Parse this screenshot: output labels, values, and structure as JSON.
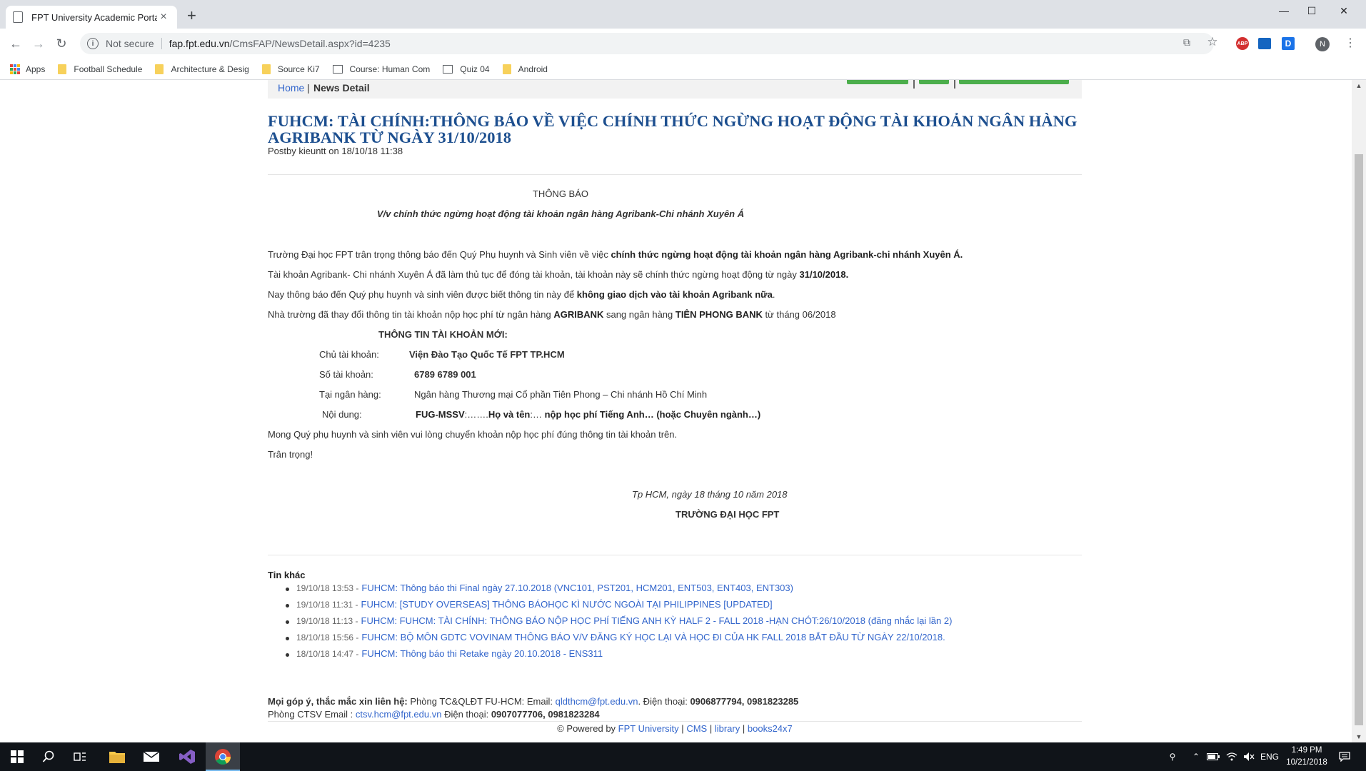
{
  "browser": {
    "tab_title": "FPT University Academic Portal",
    "tab_close": "×",
    "new_tab": "+",
    "not_secure": "Not secure",
    "url_host": "fap.fpt.edu.vn",
    "url_path": "/CmsFAP/NewsDetail.aspx?id=4235",
    "win_min": "—",
    "win_max": "☐",
    "win_close": "✕",
    "back": "←",
    "forward": "→",
    "reload": "↻",
    "info": "i",
    "translate": "⧉",
    "star": "☆",
    "abp": "ABP",
    "ext_d": "D",
    "profile_initial": "N",
    "menu": "⋮"
  },
  "bookmarks": [
    {
      "label": "Apps",
      "icon": "apps-icon"
    },
    {
      "label": "Football Schedule",
      "icon": "folder-icon"
    },
    {
      "label": "Architecture & Desig",
      "icon": "folder-icon"
    },
    {
      "label": "Source Ki7",
      "icon": "folder-icon"
    },
    {
      "label": "Course: Human Com",
      "icon": "page-icon"
    },
    {
      "label": "Quiz 04",
      "icon": "page-icon"
    },
    {
      "label": "Android",
      "icon": "folder-icon"
    }
  ],
  "breadcrumb": {
    "home": "Home",
    "separator": "|",
    "current": "News Detail"
  },
  "news": {
    "title": "FUHCM: TÀI CHÍNH:THÔNG BÁO VỀ VIỆC CHÍNH THỨC NGỪNG HOẠT ĐỘNG TÀI KHOẢN NGÂN HÀNG AGRIBANK TỪ NGÀY 31/10/2018",
    "postby": "Postby kieuntt on 18/10/18 11:38"
  },
  "body": {
    "heading": "THÔNG BÁO",
    "subheading": "V/v chính thức ngừng hoạt động tài khoản ngân hàng Agribank-Chi nhánh Xuyên Á",
    "p1a": "Trường Đại học FPT trân trọng thông báo đến Quý Phụ huynh và Sinh viên về việc ",
    "p1b": "chính thức ngừng hoạt động tài khoản ngân hàng Agribank-chi nhánh Xuyên Á.",
    "p2a": "Tài khoản Agribank- Chi nhánh Xuyên Á đã làm thủ tục để đóng tài khoản,  tài khoản này sẽ chính thức ngừng hoạt động từ ngày ",
    "p2b": "31/10/2018.",
    "p3a": "Nay thông báo đến Quý phụ huynh và sinh viên được biết thông tin này để ",
    "p3b": "không giao dịch vào tài khoản Agribank nữa",
    "p3c": ".",
    "p4a": "Nhà trường đã thay đổi thông tin tài khoản nộp học phí từ ngân hàng ",
    "p4b": "AGRIBANK",
    "p4c": " sang ngân hàng ",
    "p4d": "TIÊN PHONG BANK",
    "p4e": " từ tháng 06/2018",
    "new_account_heading": "THÔNG TIN TÀI KHOẢN MỚI:",
    "owner_label": "Chủ tài khoản:",
    "owner_value": "Viện Đào Tạo Quốc Tế FPT TP.HCM",
    "number_label": "Số tài khoản:",
    "number_value": "6789 6789 001",
    "bank_label": "Tại ngân hàng:",
    "bank_value": "Ngân hàng Thương mại Cổ phần Tiên Phong – Chi nhánh Hồ Chí Minh",
    "content_label": "Nội dung:",
    "content_a": "FUG-MSSV",
    "content_b": ":…….",
    "content_c": "Họ và tên",
    "content_d": ":…  ",
    "content_e": "nộp học phí Tiếng Anh… (hoặc Chuyên ngành…)",
    "closing": "Mong Quý phụ huynh và sinh viên vui lòng chuyển khoản nộp học phí đúng thông tin tài khoản trên.",
    "regards": "Trân trọng!",
    "date_line": "Tp HCM, ngày 18 tháng 10 năm 2018",
    "signature": "TRƯỜNG ĐẠI HỌC FPT"
  },
  "other_news": {
    "heading": "Tin khác",
    "items": [
      {
        "date": "19/10/18 13:53 -",
        "title": "FUHCM: Thông báo thi Final ngày 27.10.2018 (VNC101, PST201, HCM201, ENT503, ENT403, ENT303)"
      },
      {
        "date": "19/10/18 11:31 -",
        "title": "FUHCM: [STUDY OVERSEAS] THÔNG BÁOHỌC KÌ NƯỚC NGOÀI TẠI PHILIPPINES [UPDATED]"
      },
      {
        "date": "19/10/18 11:13 -",
        "title": "FUHCM: FUHCM: TÀI CHÍNH: THÔNG BÁO NỘP HỌC PHÍ TIẾNG ANH KỲ HALF 2 - FALL 2018 -HẠN CHÓT:26/10/2018 (đăng nhắc lại lần 2)"
      },
      {
        "date": "18/10/18 15:56 -",
        "title": "FUHCM: BỘ MÔN GDTC VOVINAM THÔNG BÁO V/V ĐĂNG KÝ HỌC LẠI VÀ HỌC ĐI CỦA HK FALL 2018 BẮT ĐẦU TỪ NGÀY 22/10/2018."
      },
      {
        "date": "18/10/18 14:47 -",
        "title": "FUHCM: Thông báo thi Retake ngày 20.10.2018 - ENS311"
      }
    ]
  },
  "footer": {
    "line1_label": "Mọi góp ý, thắc mắc xin liên hệ:",
    "line1_a": " Phòng TC&QLĐT FU-HCM: Email: ",
    "line1_email": "qldthcm@fpt.edu.vn",
    "line1_b": ". Điện thoại: ",
    "line1_phone": "0906877794, 0981823285",
    "line2_a": "Phòng CTSV Email : ",
    "line2_email": "ctsv.hcm@fpt.edu.vn",
    "line2_b": " Điện thoại: ",
    "line2_phone": "0907077706, 0981823284",
    "powered_by": "© Powered by ",
    "links": [
      "FPT University",
      "CMS",
      "library",
      "books24x7"
    ],
    "link_sep": "|"
  },
  "taskbar": {
    "lang": "ENG",
    "time": "1:49 PM",
    "date": "10/21/2018"
  },
  "colors": {
    "title_blue": "#1d4f8f",
    "link_blue": "#3366cc",
    "green_button": "#4cae4c",
    "taskbar": "#101419"
  }
}
